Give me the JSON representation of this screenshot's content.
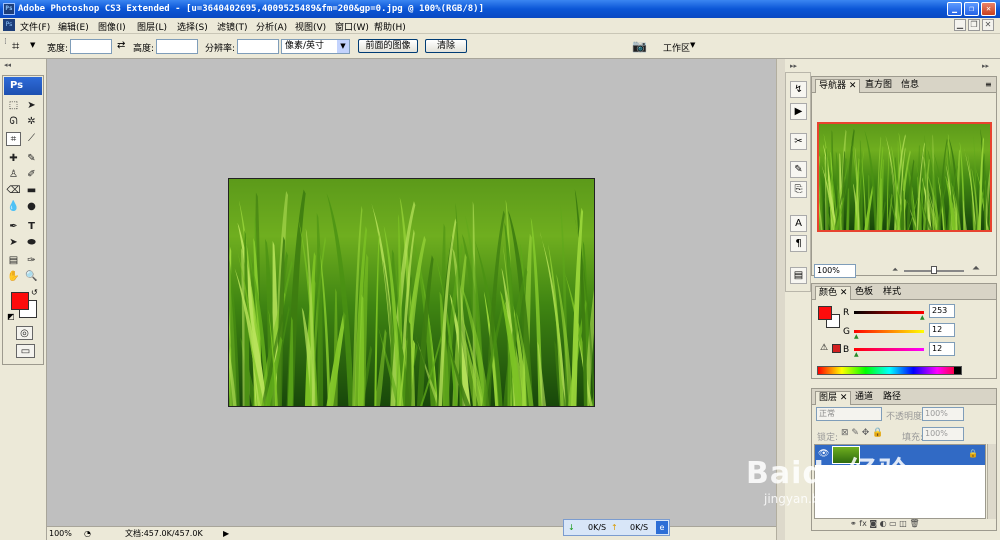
{
  "window": {
    "app_badge": "Ps",
    "title": "Adobe Photoshop CS3 Extended - [u=3640402695,4009525489&fm=200&gp=0.jpg @ 100%(RGB/8)]"
  },
  "menu": [
    "文件(F)",
    "编辑(E)",
    "图像(I)",
    "图层(L)",
    "选择(S)",
    "滤镜(T)",
    "分析(A)",
    "视图(V)",
    "窗口(W)",
    "帮助(H)"
  ],
  "options": {
    "width_label": "宽度:",
    "height_label": "高度:",
    "resolution_label": "分辨率:",
    "unit_value": "像素/英寸",
    "front_image_button": "前面的图像",
    "clear_button": "清除",
    "workspace_label": "工作区"
  },
  "toolbox": {
    "logo": "Ps"
  },
  "foreground_color": "#fd0c0c",
  "navigator": {
    "tabs": [
      "导航器",
      "直方图",
      "信息"
    ],
    "zoom": "100%"
  },
  "color_panel": {
    "tabs": [
      "颜色",
      "色板",
      "样式"
    ],
    "channels": [
      {
        "label": "R",
        "value": "253"
      },
      {
        "label": "G",
        "value": "12"
      },
      {
        "label": "B",
        "value": "12"
      }
    ]
  },
  "layers_panel": {
    "tabs": [
      "图层",
      "通道",
      "路径"
    ],
    "blend_mode": "正常",
    "opacity_label": "不透明度:",
    "opacity_value": "100%",
    "lock_label": "锁定:",
    "fill_label": "填充:",
    "fill_value": "100%"
  },
  "status": {
    "zoom": "100%",
    "doc_info": "文档:457.0K/457.0K"
  },
  "network": {
    "down": "0K/S",
    "up": "0K/S"
  },
  "watermark": {
    "main": "Baidu经验",
    "url": "jingyan.baidu.com"
  }
}
